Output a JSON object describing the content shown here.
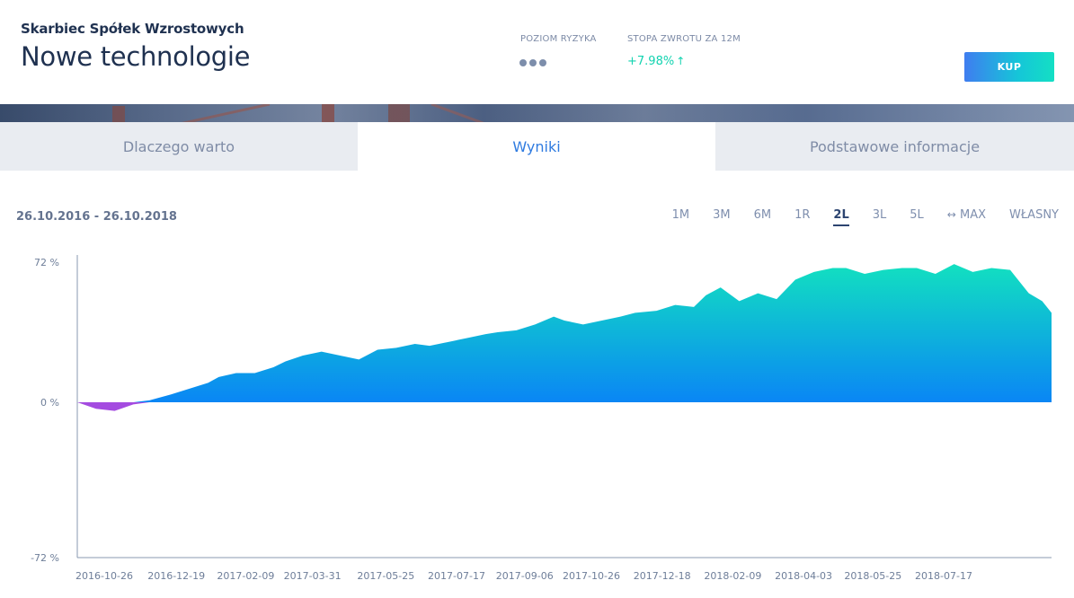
{
  "header": {
    "subtitle": "Skarbiec Spółek Wzrostowych",
    "title": "Nowe technologie",
    "risk_label": "POZIOM RYZYKA",
    "risk_level": 3,
    "return_label": "STOPA ZWROTU ZA 12M",
    "return_value": "+7.98%",
    "return_icon": "arrow-up-icon",
    "buy_label": "KUP"
  },
  "tabs": [
    {
      "label": "Dlaczego warto",
      "active": false
    },
    {
      "label": "Wyniki",
      "active": true
    },
    {
      "label": "Podstawowe informacje",
      "active": false
    }
  ],
  "range": {
    "text": "26.10.2016 - 26.10.2018",
    "periods": [
      "1M",
      "3M",
      "6M",
      "1R",
      "2L",
      "3L",
      "5L",
      "MAX",
      "WŁASNY"
    ],
    "active_period": "2L",
    "max_icon": "double-arrow-icon"
  },
  "colors": {
    "positive_top": "#12e0c0",
    "positive_bottom": "#0a86f5",
    "negative": "#a44be0",
    "accent_text": "#2f7be0",
    "return_green": "#12d3b0"
  },
  "chart_data": {
    "type": "area",
    "title": "",
    "xlabel": "",
    "ylabel": "",
    "ylim": [
      -72,
      72
    ],
    "y_ticks": [
      "72 %",
      "0 %",
      "-72 %"
    ],
    "x_ticks": [
      "2016-10-26",
      "2016-12-19",
      "2017-02-09",
      "2017-03-31",
      "2017-05-25",
      "2017-07-17",
      "2017-09-06",
      "2017-10-26",
      "2017-12-18",
      "2018-02-09",
      "2018-04-03",
      "2018-05-25",
      "2018-07-17"
    ],
    "x": [
      "2016-10-26",
      "2016-11-09",
      "2016-11-23",
      "2016-12-07",
      "2016-12-19",
      "2017-01-04",
      "2017-01-18",
      "2017-02-01",
      "2017-02-09",
      "2017-02-22",
      "2017-03-08",
      "2017-03-22",
      "2017-03-31",
      "2017-04-13",
      "2017-04-27",
      "2017-05-11",
      "2017-05-25",
      "2017-06-08",
      "2017-06-22",
      "2017-07-06",
      "2017-07-17",
      "2017-07-31",
      "2017-08-14",
      "2017-08-28",
      "2017-09-06",
      "2017-09-20",
      "2017-10-04",
      "2017-10-18",
      "2017-10-26",
      "2017-11-09",
      "2017-11-23",
      "2017-12-07",
      "2017-12-18",
      "2018-01-03",
      "2018-01-17",
      "2018-01-31",
      "2018-02-09",
      "2018-02-20",
      "2018-03-06",
      "2018-03-20",
      "2018-04-03",
      "2018-04-17",
      "2018-05-01",
      "2018-05-15",
      "2018-05-25",
      "2018-06-08",
      "2018-06-22",
      "2018-07-06",
      "2018-07-17",
      "2018-07-31",
      "2018-08-14",
      "2018-08-28",
      "2018-09-11",
      "2018-09-25",
      "2018-10-09",
      "2018-10-19",
      "2018-10-26"
    ],
    "series": [
      {
        "values": [
          0,
          -3,
          -4,
          -1,
          1,
          4,
          7,
          10,
          13,
          15,
          15,
          18,
          21,
          24,
          26,
          24,
          22,
          27,
          28,
          30,
          29,
          31,
          33,
          35,
          36,
          37,
          40,
          44,
          42,
          40,
          42,
          44,
          46,
          47,
          50,
          49,
          55,
          59,
          52,
          56,
          53,
          63,
          67,
          69,
          69,
          66,
          68,
          69,
          69,
          66,
          71,
          67,
          69,
          68,
          56,
          52,
          46
        ]
      }
    ]
  }
}
